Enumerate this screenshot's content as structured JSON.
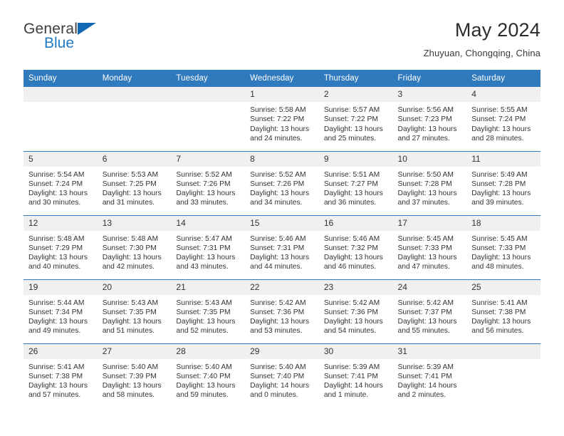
{
  "brand": {
    "name_part1": "General",
    "name_part2": "Blue",
    "accent_color": "#1268b3"
  },
  "header": {
    "title": "May 2024",
    "subtitle": "Zhuyuan, Chongqing, China"
  },
  "calendar": {
    "header_bg": "#2f79bd",
    "daynum_bg": "#f0f0f0",
    "weekdays": [
      "Sunday",
      "Monday",
      "Tuesday",
      "Wednesday",
      "Thursday",
      "Friday",
      "Saturday"
    ],
    "weeks": [
      [
        {
          "day": "",
          "sunrise": "",
          "sunset": "",
          "daylight_1": "",
          "daylight_2": ""
        },
        {
          "day": "",
          "sunrise": "",
          "sunset": "",
          "daylight_1": "",
          "daylight_2": ""
        },
        {
          "day": "",
          "sunrise": "",
          "sunset": "",
          "daylight_1": "",
          "daylight_2": ""
        },
        {
          "day": "1",
          "sunrise": "Sunrise: 5:58 AM",
          "sunset": "Sunset: 7:22 PM",
          "daylight_1": "Daylight: 13 hours",
          "daylight_2": "and 24 minutes."
        },
        {
          "day": "2",
          "sunrise": "Sunrise: 5:57 AM",
          "sunset": "Sunset: 7:22 PM",
          "daylight_1": "Daylight: 13 hours",
          "daylight_2": "and 25 minutes."
        },
        {
          "day": "3",
          "sunrise": "Sunrise: 5:56 AM",
          "sunset": "Sunset: 7:23 PM",
          "daylight_1": "Daylight: 13 hours",
          "daylight_2": "and 27 minutes."
        },
        {
          "day": "4",
          "sunrise": "Sunrise: 5:55 AM",
          "sunset": "Sunset: 7:24 PM",
          "daylight_1": "Daylight: 13 hours",
          "daylight_2": "and 28 minutes."
        }
      ],
      [
        {
          "day": "5",
          "sunrise": "Sunrise: 5:54 AM",
          "sunset": "Sunset: 7:24 PM",
          "daylight_1": "Daylight: 13 hours",
          "daylight_2": "and 30 minutes."
        },
        {
          "day": "6",
          "sunrise": "Sunrise: 5:53 AM",
          "sunset": "Sunset: 7:25 PM",
          "daylight_1": "Daylight: 13 hours",
          "daylight_2": "and 31 minutes."
        },
        {
          "day": "7",
          "sunrise": "Sunrise: 5:52 AM",
          "sunset": "Sunset: 7:26 PM",
          "daylight_1": "Daylight: 13 hours",
          "daylight_2": "and 33 minutes."
        },
        {
          "day": "8",
          "sunrise": "Sunrise: 5:52 AM",
          "sunset": "Sunset: 7:26 PM",
          "daylight_1": "Daylight: 13 hours",
          "daylight_2": "and 34 minutes."
        },
        {
          "day": "9",
          "sunrise": "Sunrise: 5:51 AM",
          "sunset": "Sunset: 7:27 PM",
          "daylight_1": "Daylight: 13 hours",
          "daylight_2": "and 36 minutes."
        },
        {
          "day": "10",
          "sunrise": "Sunrise: 5:50 AM",
          "sunset": "Sunset: 7:28 PM",
          "daylight_1": "Daylight: 13 hours",
          "daylight_2": "and 37 minutes."
        },
        {
          "day": "11",
          "sunrise": "Sunrise: 5:49 AM",
          "sunset": "Sunset: 7:28 PM",
          "daylight_1": "Daylight: 13 hours",
          "daylight_2": "and 39 minutes."
        }
      ],
      [
        {
          "day": "12",
          "sunrise": "Sunrise: 5:48 AM",
          "sunset": "Sunset: 7:29 PM",
          "daylight_1": "Daylight: 13 hours",
          "daylight_2": "and 40 minutes."
        },
        {
          "day": "13",
          "sunrise": "Sunrise: 5:48 AM",
          "sunset": "Sunset: 7:30 PM",
          "daylight_1": "Daylight: 13 hours",
          "daylight_2": "and 42 minutes."
        },
        {
          "day": "14",
          "sunrise": "Sunrise: 5:47 AM",
          "sunset": "Sunset: 7:31 PM",
          "daylight_1": "Daylight: 13 hours",
          "daylight_2": "and 43 minutes."
        },
        {
          "day": "15",
          "sunrise": "Sunrise: 5:46 AM",
          "sunset": "Sunset: 7:31 PM",
          "daylight_1": "Daylight: 13 hours",
          "daylight_2": "and 44 minutes."
        },
        {
          "day": "16",
          "sunrise": "Sunrise: 5:46 AM",
          "sunset": "Sunset: 7:32 PM",
          "daylight_1": "Daylight: 13 hours",
          "daylight_2": "and 46 minutes."
        },
        {
          "day": "17",
          "sunrise": "Sunrise: 5:45 AM",
          "sunset": "Sunset: 7:33 PM",
          "daylight_1": "Daylight: 13 hours",
          "daylight_2": "and 47 minutes."
        },
        {
          "day": "18",
          "sunrise": "Sunrise: 5:45 AM",
          "sunset": "Sunset: 7:33 PM",
          "daylight_1": "Daylight: 13 hours",
          "daylight_2": "and 48 minutes."
        }
      ],
      [
        {
          "day": "19",
          "sunrise": "Sunrise: 5:44 AM",
          "sunset": "Sunset: 7:34 PM",
          "daylight_1": "Daylight: 13 hours",
          "daylight_2": "and 49 minutes."
        },
        {
          "day": "20",
          "sunrise": "Sunrise: 5:43 AM",
          "sunset": "Sunset: 7:35 PM",
          "daylight_1": "Daylight: 13 hours",
          "daylight_2": "and 51 minutes."
        },
        {
          "day": "21",
          "sunrise": "Sunrise: 5:43 AM",
          "sunset": "Sunset: 7:35 PM",
          "daylight_1": "Daylight: 13 hours",
          "daylight_2": "and 52 minutes."
        },
        {
          "day": "22",
          "sunrise": "Sunrise: 5:42 AM",
          "sunset": "Sunset: 7:36 PM",
          "daylight_1": "Daylight: 13 hours",
          "daylight_2": "and 53 minutes."
        },
        {
          "day": "23",
          "sunrise": "Sunrise: 5:42 AM",
          "sunset": "Sunset: 7:36 PM",
          "daylight_1": "Daylight: 13 hours",
          "daylight_2": "and 54 minutes."
        },
        {
          "day": "24",
          "sunrise": "Sunrise: 5:42 AM",
          "sunset": "Sunset: 7:37 PM",
          "daylight_1": "Daylight: 13 hours",
          "daylight_2": "and 55 minutes."
        },
        {
          "day": "25",
          "sunrise": "Sunrise: 5:41 AM",
          "sunset": "Sunset: 7:38 PM",
          "daylight_1": "Daylight: 13 hours",
          "daylight_2": "and 56 minutes."
        }
      ],
      [
        {
          "day": "26",
          "sunrise": "Sunrise: 5:41 AM",
          "sunset": "Sunset: 7:38 PM",
          "daylight_1": "Daylight: 13 hours",
          "daylight_2": "and 57 minutes."
        },
        {
          "day": "27",
          "sunrise": "Sunrise: 5:40 AM",
          "sunset": "Sunset: 7:39 PM",
          "daylight_1": "Daylight: 13 hours",
          "daylight_2": "and 58 minutes."
        },
        {
          "day": "28",
          "sunrise": "Sunrise: 5:40 AM",
          "sunset": "Sunset: 7:40 PM",
          "daylight_1": "Daylight: 13 hours",
          "daylight_2": "and 59 minutes."
        },
        {
          "day": "29",
          "sunrise": "Sunrise: 5:40 AM",
          "sunset": "Sunset: 7:40 PM",
          "daylight_1": "Daylight: 14 hours",
          "daylight_2": "and 0 minutes."
        },
        {
          "day": "30",
          "sunrise": "Sunrise: 5:39 AM",
          "sunset": "Sunset: 7:41 PM",
          "daylight_1": "Daylight: 14 hours",
          "daylight_2": "and 1 minute."
        },
        {
          "day": "31",
          "sunrise": "Sunrise: 5:39 AM",
          "sunset": "Sunset: 7:41 PM",
          "daylight_1": "Daylight: 14 hours",
          "daylight_2": "and 2 minutes."
        },
        {
          "day": "",
          "sunrise": "",
          "sunset": "",
          "daylight_1": "",
          "daylight_2": ""
        }
      ]
    ]
  }
}
